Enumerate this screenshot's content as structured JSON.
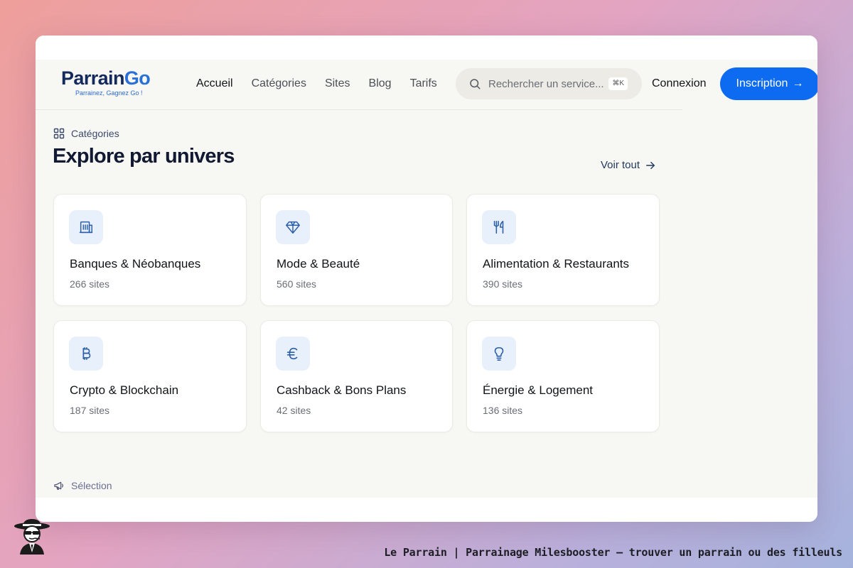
{
  "brand": {
    "name_part1": "Parrain",
    "name_part2": "Go",
    "tagline": "Parrainez, Gagnez Go !",
    "primary_color": "#0c6bf0",
    "navy_color": "#152a5c"
  },
  "nav": {
    "items": [
      "Accueil",
      "Catégories",
      "Sites",
      "Blog",
      "Tarifs"
    ],
    "active": "Accueil"
  },
  "search": {
    "placeholder": "Rechercher un service...",
    "shortcut": "⌘K",
    "icon": "search-icon"
  },
  "auth": {
    "login_label": "Connexion",
    "signup_label": "Inscription",
    "signup_arrow": "→"
  },
  "categories_section": {
    "label": "Catégories",
    "label_icon": "grid-icon",
    "title": "Explore par univers",
    "see_all": "Voir tout",
    "see_all_icon": "arrow-right-icon",
    "cards": [
      {
        "name": "Banques & Néobanques",
        "count": "266 sites",
        "icon": "bank-icon"
      },
      {
        "name": "Mode & Beauté",
        "count": "560 sites",
        "icon": "diamond-icon"
      },
      {
        "name": "Alimentation & Restaurants",
        "count": "390 sites",
        "icon": "utensils-icon"
      },
      {
        "name": "Crypto & Blockchain",
        "count": "187 sites",
        "icon": "bitcoin-icon"
      },
      {
        "name": "Cashback & Bons Plans",
        "count": "42 sites",
        "icon": "euro-icon"
      },
      {
        "name": "Énergie & Logement",
        "count": "136 sites",
        "icon": "lightbulb-icon"
      }
    ]
  },
  "selection_section": {
    "label": "Sélection",
    "label_icon": "megaphone-icon"
  },
  "footer": {
    "caption": "Le Parrain | Parrainage Milesbooster — trouver un parrain ou des filleuls",
    "avatar_icon": "mascot-icon"
  }
}
